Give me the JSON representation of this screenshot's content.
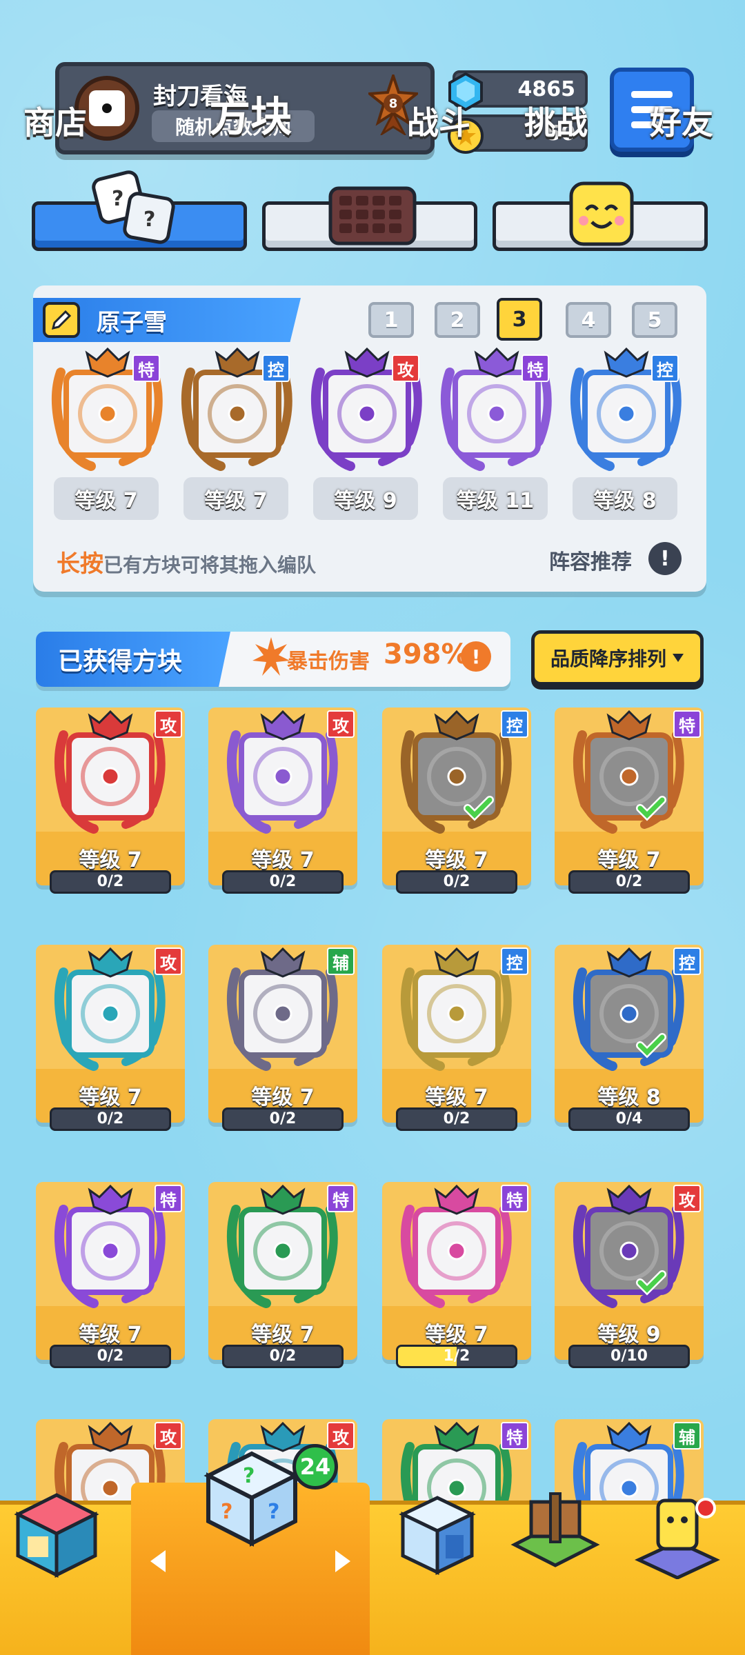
{
  "header": {
    "player_name": "封刀看海",
    "player_title": "随机点数大师",
    "rank_level": "8",
    "gems": "4865",
    "coins": "50"
  },
  "deck": {
    "title": "原子雪",
    "numbers": [
      "1",
      "2",
      "3",
      "4",
      "5"
    ],
    "active_number": "3",
    "slots": [
      {
        "tag": "特",
        "type": "spc",
        "level": "等级 7",
        "color": "#e8832b"
      },
      {
        "tag": "控",
        "type": "ctl",
        "level": "等级 7",
        "color": "#a86a2a"
      },
      {
        "tag": "攻",
        "type": "atk",
        "level": "等级 9",
        "color": "#7b3fc6"
      },
      {
        "tag": "特",
        "type": "spc",
        "level": "等级 11",
        "color": "#8b5ad8"
      },
      {
        "tag": "控",
        "type": "ctl",
        "level": "等级 8",
        "color": "#3a7ee0"
      }
    ],
    "hint_highlight": "长按",
    "hint_text": "已有方块可将其拖入编队",
    "recommend_label": "阵容推荐",
    "recommend_icon": "!"
  },
  "owned": {
    "title": "已获得方块",
    "crit_label": "暴击伤害",
    "crit_value": "398%",
    "crit_icon": "!",
    "sort_label": "品质降序排列",
    "cards": [
      {
        "tag": "攻",
        "type": "atk",
        "level": "等级 7",
        "progress": "0/2",
        "fill": 0,
        "color": "#d93a3a",
        "checked": false,
        "gray": false
      },
      {
        "tag": "攻",
        "type": "atk",
        "level": "等级 7",
        "progress": "0/2",
        "fill": 0,
        "color": "#8a5ad0",
        "checked": false,
        "gray": false
      },
      {
        "tag": "控",
        "type": "ctl",
        "level": "等级 7",
        "progress": "0/2",
        "fill": 0,
        "color": "#9a6428",
        "checked": true,
        "gray": true
      },
      {
        "tag": "特",
        "type": "spc",
        "level": "等级 7",
        "progress": "0/2",
        "fill": 0,
        "color": "#c0672a",
        "checked": true,
        "gray": true
      },
      {
        "tag": "攻",
        "type": "atk",
        "level": "等级 7",
        "progress": "0/2",
        "fill": 0,
        "color": "#2aa6b8",
        "checked": false,
        "gray": false
      },
      {
        "tag": "辅",
        "type": "sup",
        "level": "等级 7",
        "progress": "0/2",
        "fill": 0,
        "color": "#6e6a88",
        "checked": false,
        "gray": false
      },
      {
        "tag": "控",
        "type": "ctl",
        "level": "等级 7",
        "progress": "0/2",
        "fill": 0,
        "color": "#b89a3a",
        "checked": false,
        "gray": false
      },
      {
        "tag": "控",
        "type": "ctl",
        "level": "等级 8",
        "progress": "0/4",
        "fill": 0,
        "color": "#2f6bc8",
        "checked": true,
        "gray": true
      },
      {
        "tag": "特",
        "type": "spc",
        "level": "等级 7",
        "progress": "0/2",
        "fill": 0,
        "color": "#8a4ad8",
        "checked": false,
        "gray": false
      },
      {
        "tag": "特",
        "type": "spc",
        "level": "等级 7",
        "progress": "0/2",
        "fill": 0,
        "color": "#2a9a54",
        "checked": false,
        "gray": false
      },
      {
        "tag": "特",
        "type": "spc",
        "level": "等级 7",
        "progress": "1/2",
        "fill": 0.5,
        "color": "#d84aa0",
        "checked": false,
        "gray": false
      },
      {
        "tag": "攻",
        "type": "atk",
        "level": "等级 9",
        "progress": "0/10",
        "fill": 0,
        "color": "#6a3ab8",
        "checked": true,
        "gray": true
      },
      {
        "tag": "攻",
        "type": "atk",
        "level": "",
        "progress": "",
        "fill": 0,
        "color": "#c0672a",
        "checked": false,
        "gray": false
      },
      {
        "tag": "攻",
        "type": "atk",
        "level": "",
        "progress": "",
        "fill": 0,
        "color": "#2a9ab8",
        "checked": false,
        "gray": false
      },
      {
        "tag": "特",
        "type": "spc",
        "level": "",
        "progress": "",
        "fill": 0,
        "color": "#2a9a54",
        "checked": false,
        "gray": false
      },
      {
        "tag": "辅",
        "type": "sup",
        "level": "",
        "progress": "",
        "fill": 0,
        "color": "#3a7ee0",
        "checked": false,
        "gray": false
      }
    ]
  },
  "nav": {
    "shop": "商店",
    "blocks": "方块",
    "blocks_count": "24",
    "battle": "战斗",
    "challenge": "挑战",
    "friends": "好友"
  },
  "colors": {
    "background": "#8fd8f2",
    "accent_blue": "#2f7ff0",
    "accent_yellow": "#ffd43b",
    "card_orange": "#f8c65b",
    "crit_orange": "#f07a2a"
  }
}
